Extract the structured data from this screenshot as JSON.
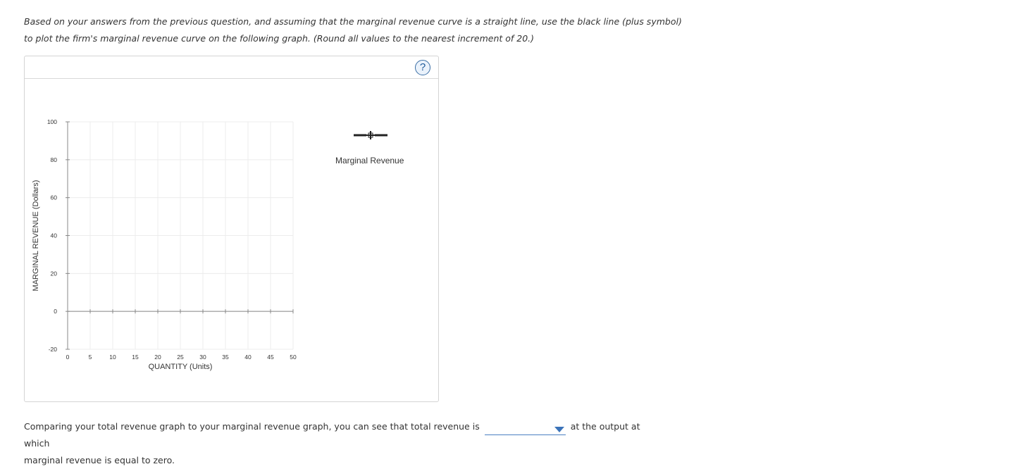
{
  "instructions": {
    "line1": "Based on your answers from the previous question, and assuming that the marginal revenue curve is a straight line, use the black line (plus symbol)",
    "line2": "to plot the firm's marginal revenue curve on the following graph. (Round all values to the nearest increment of 20.)"
  },
  "toolbar": {
    "help_label": "?"
  },
  "legend": {
    "tool_label": "Marginal Revenue",
    "tool_icon": "plus-line-tool-icon"
  },
  "chart_data": {
    "type": "line",
    "xlabel": "QUANTITY (Units)",
    "ylabel": "MARGINAL REVENUE (Dollars)",
    "xlim": [
      0,
      50
    ],
    "ylim": [
      -20,
      100
    ],
    "x_ticks": [
      0,
      5,
      10,
      15,
      20,
      25,
      30,
      35,
      40,
      45,
      50
    ],
    "y_ticks": [
      -20,
      0,
      20,
      40,
      60,
      80,
      100
    ],
    "grid": true,
    "series": []
  },
  "question": {
    "text_before": "Comparing your total revenue graph to your marginal revenue graph, you can see that total revenue is",
    "dropdown_value": "",
    "text_after": "at the output at which",
    "line2": "marginal revenue is equal to zero."
  },
  "colors": {
    "grid": "#ececec",
    "axis": "#888888",
    "link_blue": "#3b73b9"
  }
}
